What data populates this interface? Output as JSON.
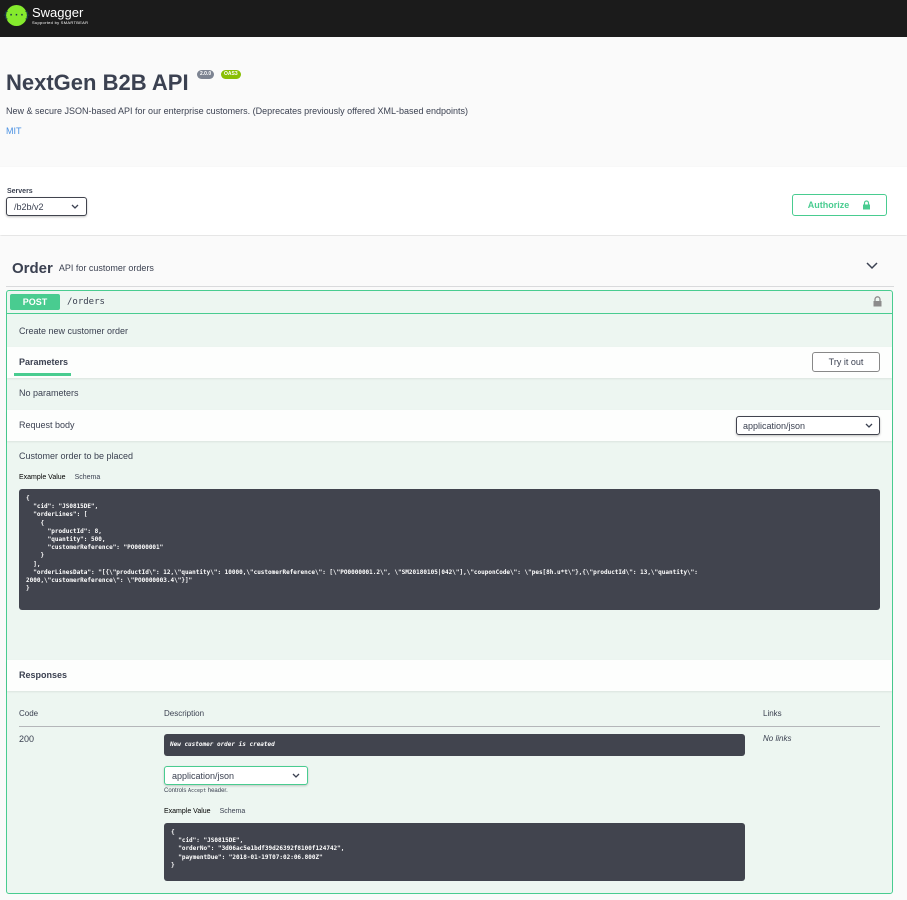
{
  "topbar": {
    "logo_glyph": "{···}",
    "logo_title": "Swagger",
    "logo_subtitle": "Supported by SMARTBEAR"
  },
  "info": {
    "title": "NextGen B2B API",
    "version_badge": "2.0.0",
    "oas_badge": "OAS3",
    "description": "New & secure JSON-based API for our enterprise customers. (Deprecates previously offered XML-based endpoints)",
    "license": "MIT"
  },
  "servers": {
    "label": "Servers",
    "selected": "/b2b/v2"
  },
  "authorize": {
    "label": "Authorize",
    "icon": "lock-icon"
  },
  "tag": {
    "name": "Order",
    "description": "API for customer orders",
    "icon": "chevron-down-icon"
  },
  "operation": {
    "method": "POST",
    "path": "/orders",
    "summary": "Create new customer order",
    "parameters_tab": "Parameters",
    "try_it_out": "Try it out",
    "no_parameters": "No parameters",
    "request_body_label": "Request body",
    "request_content_type": "application/json",
    "request_body_description": "Customer order to be placed",
    "example_value_tab": "Example Value",
    "schema_tab": "Schema",
    "request_example": "{\n  \"cid\": \"JS0815DE\",\n  \"orderLines\": [\n    {\n      \"productId\": 8,\n      \"quantity\": 500,\n      \"customerReference\": \"PO0000001\"\n    }\n  ],\n  \"orderLinesData\": \"[{\\\"productId\\\": 12,\\\"quantity\\\": 10000,\\\"customerReference\\\": [\\\"PO0000001.2\\\", \\\"SM20180105|042\\\"],\\\"couponCode\\\": \\\"pes[8h.u*t\\\"},{\\\"productId\\\": 13,\\\"quantity\\\":\n2000,\\\"customerReference\\\": \\\"PO0000003.4\\\"}]\"\n}"
  },
  "responses": {
    "label": "Responses",
    "col_code": "Code",
    "col_description": "Description",
    "col_links": "Links",
    "row": {
      "code": "200",
      "description": "New customer order is created",
      "links": "No links",
      "content_type": "application/json",
      "controls_prefix": "Controls",
      "controls_header": "Accept",
      "controls_suffix": "header.",
      "example_value_tab": "Example Value",
      "schema_tab": "Schema",
      "example": "{\n  \"cid\": \"JS0815DE\",\n  \"orderNo\": \"3d06ac5e1bdf39d26392f8100f124742\",\n  \"paymentDue\": \"2018-01-19T07:02:06.800Z\"\n}"
    }
  },
  "colors": {
    "accent_green": "#49cc90",
    "topbar": "#1b1b1b",
    "code_bg": "#41444e"
  }
}
